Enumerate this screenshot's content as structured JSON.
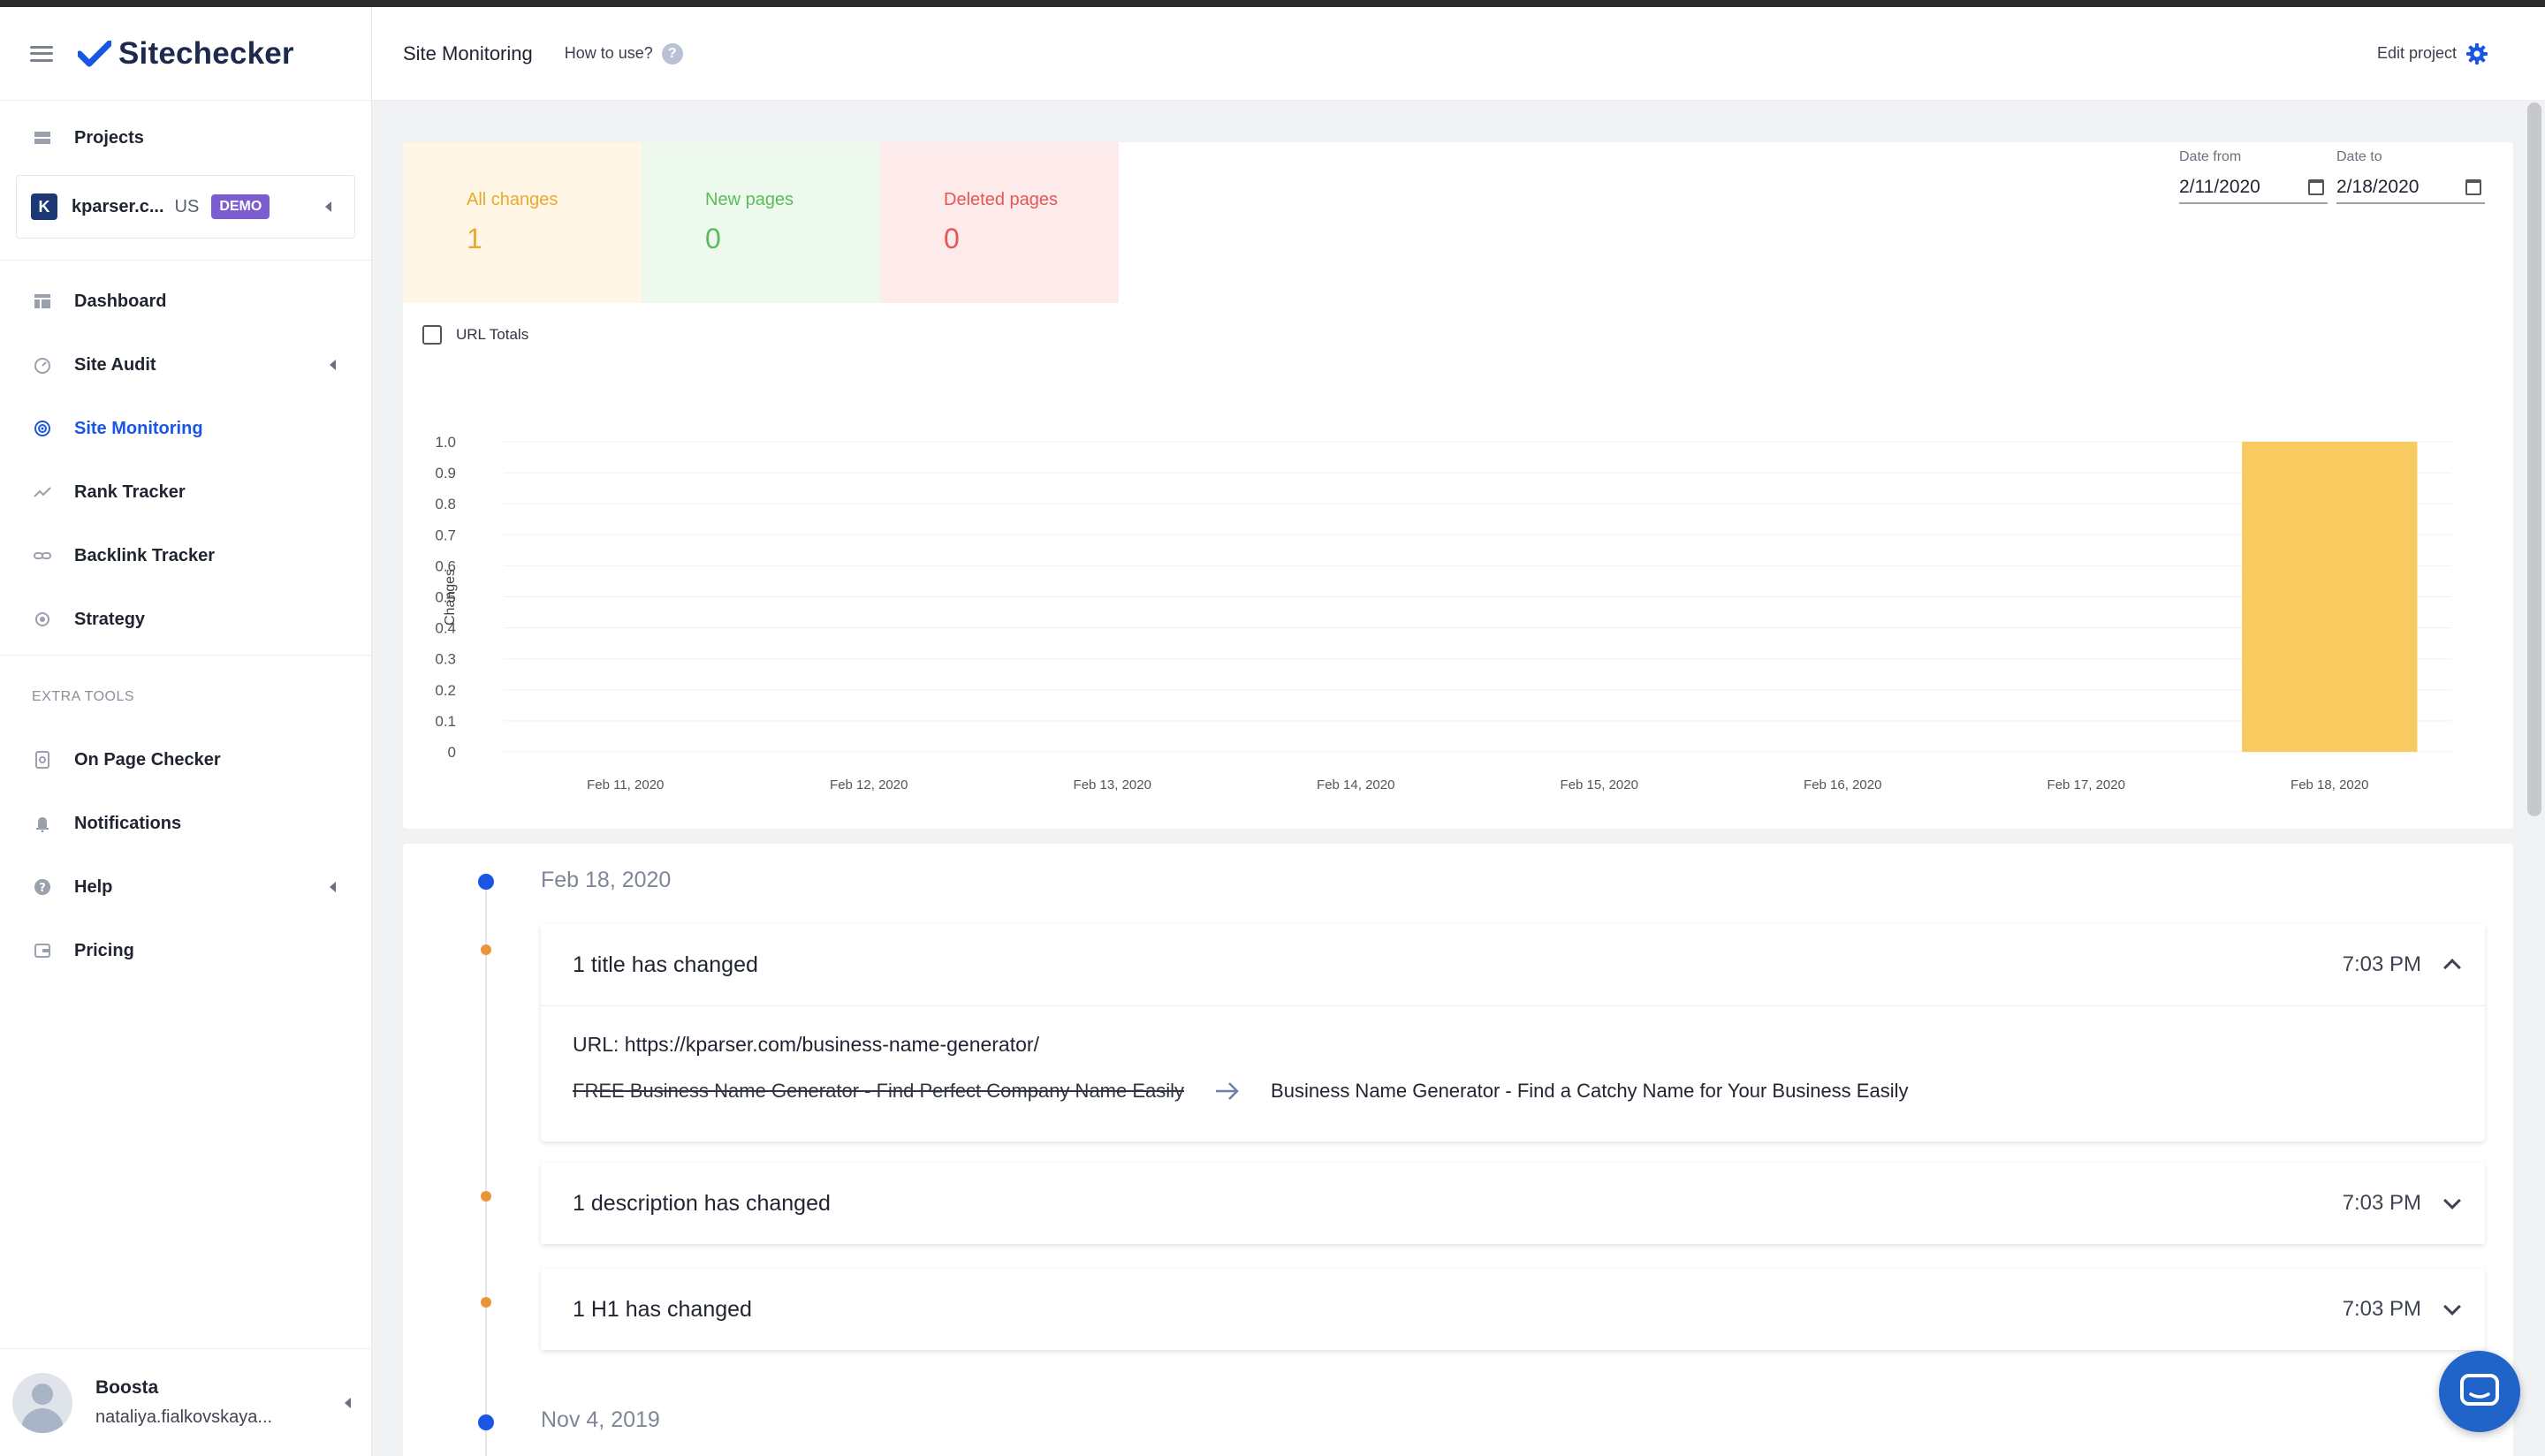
{
  "app": {
    "logo": "Sitechecker"
  },
  "sidebar": {
    "projects_label": "Projects",
    "project": {
      "initial": "K",
      "name": "kparser.c...",
      "country": "US",
      "badge": "DEMO"
    },
    "items": [
      {
        "label": "Dashboard",
        "icon": "dashboard-icon"
      },
      {
        "label": "Site Audit",
        "icon": "gauge-icon"
      },
      {
        "label": "Site Monitoring",
        "icon": "monitoring-icon"
      },
      {
        "label": "Rank Tracker",
        "icon": "trend-icon"
      },
      {
        "label": "Backlink Tracker",
        "icon": "link-icon"
      },
      {
        "label": "Strategy",
        "icon": "target-icon"
      }
    ],
    "extra_tools_label": "EXTRA TOOLS",
    "extra_items": [
      {
        "label": "On Page Checker",
        "icon": "page-search-icon"
      },
      {
        "label": "Notifications",
        "icon": "bell-icon"
      },
      {
        "label": "Help",
        "icon": "help-icon"
      },
      {
        "label": "Pricing",
        "icon": "wallet-icon"
      }
    ],
    "user": {
      "name": "Boosta",
      "email": "nataliya.fialkovskaya..."
    }
  },
  "header": {
    "title": "Site Monitoring",
    "how_to": "How to use?",
    "edit_project": "Edit project"
  },
  "stats": {
    "all_changes": {
      "label": "All changes",
      "value": "1"
    },
    "new_pages": {
      "label": "New pages",
      "value": "0"
    },
    "deleted_pages": {
      "label": "Deleted pages",
      "value": "0"
    }
  },
  "filters": {
    "date_from": {
      "label": "Date from",
      "value": "2/11/2020"
    },
    "date_to": {
      "label": "Date to",
      "value": "2/18/2020"
    },
    "url_totals": "URL Totals"
  },
  "chart_data": {
    "type": "bar",
    "categories": [
      "Feb 11, 2020",
      "Feb 12, 2020",
      "Feb 13, 2020",
      "Feb 14, 2020",
      "Feb 15, 2020",
      "Feb 16, 2020",
      "Feb 17, 2020",
      "Feb 18, 2020"
    ],
    "values": [
      0,
      0,
      0,
      0,
      0,
      0,
      0,
      1
    ],
    "ylabel": "Changes",
    "ylim": [
      0,
      1
    ],
    "yticks": [
      "0",
      "0.1",
      "0.2",
      "0.3",
      "0.4",
      "0.5",
      "0.6",
      "0.7",
      "0.8",
      "0.9",
      "1.0"
    ],
    "bar_color": "#f7cb60",
    "grid": true
  },
  "timeline": {
    "groups": [
      {
        "date": "Feb 18, 2020",
        "changes": [
          {
            "title": "1 title has changed",
            "time": "7:03 PM",
            "expanded": true,
            "url": "URL: https://kparser.com/business-name-generator/",
            "old_value": "FREE Business Name Generator - Find Perfect Company Name Easily",
            "new_value": "Business Name Generator - Find a Catchy Name for Your Business Easily"
          },
          {
            "title": "1 description has changed",
            "time": "7:03 PM",
            "expanded": false
          },
          {
            "title": "1 H1 has changed",
            "time": "7:03 PM",
            "expanded": false
          }
        ]
      },
      {
        "date": "Nov 4, 2019"
      }
    ]
  },
  "colors": {
    "accent": "#1a56e6",
    "all": "#e9a92e",
    "new": "#5bbb5b",
    "deleted": "#e35757"
  }
}
